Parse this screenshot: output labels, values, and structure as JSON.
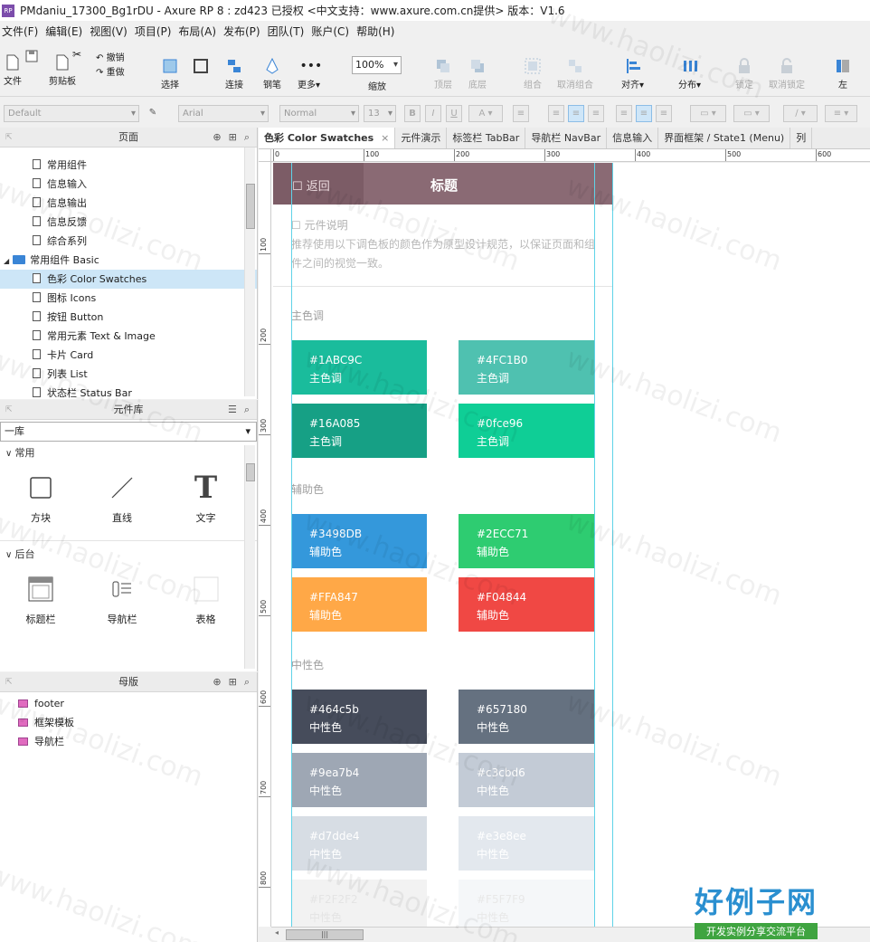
{
  "window": {
    "title": "PMdaniu_17300_Bg1rDU - Axure RP 8  : zd423 已授权       <中文支持：www.axure.com.cn提供> 版本：V1.6",
    "logo": "RP"
  },
  "menu": [
    "文件(F)",
    "编辑(E)",
    "视图(V)",
    "项目(P)",
    "布局(A)",
    "发布(P)",
    "团队(T)",
    "账户(C)",
    "帮助(H)"
  ],
  "toolbar": {
    "file": "文件",
    "clipboard": "剪贴板",
    "undo": "撤销",
    "redo": "重做",
    "select": "选择",
    "connect": "连接",
    "pen": "钢笔",
    "more": "更多▾",
    "zoom_value": "100%",
    "zoom_label": "缩放",
    "top": "顶层",
    "bottom": "底层",
    "group": "组合",
    "ungroup": "取消组合",
    "align": "对齐▾",
    "distribute": "分布▾",
    "lock": "锁定",
    "unlock": "取消锁定",
    "left": "左"
  },
  "format": {
    "style": "Default",
    "font": "Arial",
    "weight": "Normal",
    "size": "13"
  },
  "pages_panel": {
    "title": "页面",
    "items": [
      {
        "label": "常用组件",
        "type": "page",
        "indent": 1
      },
      {
        "label": "信息输入",
        "type": "page",
        "indent": 1
      },
      {
        "label": "信息输出",
        "type": "page",
        "indent": 1
      },
      {
        "label": "信息反馈",
        "type": "page",
        "indent": 1
      },
      {
        "label": "综合系列",
        "type": "page",
        "indent": 1
      },
      {
        "label": "常用组件 Basic",
        "type": "folder",
        "indent": 0
      },
      {
        "label": "色彩 Color Swatches",
        "type": "page",
        "indent": 1,
        "selected": true
      },
      {
        "label": "图标 Icons",
        "type": "page",
        "indent": 1
      },
      {
        "label": "按钮 Button",
        "type": "page",
        "indent": 1
      },
      {
        "label": "常用元素 Text & Image",
        "type": "page",
        "indent": 1
      },
      {
        "label": "卡片 Card",
        "type": "page",
        "indent": 1
      },
      {
        "label": "列表 List",
        "type": "page",
        "indent": 1
      },
      {
        "label": "状态栏 Status Bar",
        "type": "page",
        "indent": 1
      }
    ]
  },
  "library_panel": {
    "title": "元件库",
    "library": "一库",
    "groups": [
      {
        "title": "常用",
        "widgets": [
          {
            "label": "方块",
            "icon": "square-icon"
          },
          {
            "label": "直线",
            "icon": "line-icon"
          },
          {
            "label": "文字",
            "icon": "text-icon"
          }
        ]
      },
      {
        "title": "后台",
        "widgets": [
          {
            "label": "标题栏",
            "icon": "titlebar-icon"
          },
          {
            "label": "导航栏",
            "icon": "navbar-icon"
          },
          {
            "label": "表格",
            "icon": "table-icon"
          }
        ]
      }
    ]
  },
  "masters_panel": {
    "title": "母版",
    "items": [
      "footer",
      "框架模板",
      "导航栏"
    ]
  },
  "tabs": [
    {
      "label": "色彩 Color Swatches",
      "active": true
    },
    {
      "label": "元件演示"
    },
    {
      "label": "标签栏 TabBar"
    },
    {
      "label": "导航栏 NavBar"
    },
    {
      "label": "信息输入"
    },
    {
      "label": "界面框架 / State1 (Menu)"
    },
    {
      "label": "列"
    }
  ],
  "ruler": {
    "h": [
      "0",
      "100",
      "200",
      "300",
      "400",
      "500",
      "600"
    ],
    "v": [
      "100",
      "200",
      "300",
      "400",
      "500",
      "600",
      "700",
      "800"
    ]
  },
  "canvas": {
    "navbar": {
      "back": "☐ 返回",
      "title": "标题",
      "color": "#8a6a74"
    },
    "desc_title": "☐ 元件说明",
    "desc_text": "推荐使用以下调色板的颜色作为原型设计规范，以保证页面和组件之间的视觉一致。",
    "sections": [
      {
        "title": "主色调",
        "swatches": [
          {
            "code": "#1ABC9C",
            "label": "主色调",
            "color": "#1ABC9C",
            "text_color": "#ffffff"
          },
          {
            "code": "#4FC1B0",
            "label": "主色调",
            "color": "#4FC1B0",
            "text_color": "#ffffff"
          },
          {
            "code": "#16A085",
            "label": "主色调",
            "color": "#16A085",
            "text_color": "#ffffff"
          },
          {
            "code": "#0fce96",
            "label": "主色调",
            "color": "#0fce96",
            "text_color": "#ffffff"
          }
        ]
      },
      {
        "title": "辅助色",
        "swatches": [
          {
            "code": "#3498DB",
            "label": "辅助色",
            "color": "#3498DB",
            "text_color": "#ffffff"
          },
          {
            "code": "#2ECC71",
            "label": "辅助色",
            "color": "#2ECC71",
            "text_color": "#ffffff"
          },
          {
            "code": "#FFA847",
            "label": "辅助色",
            "color": "#FFA847",
            "text_color": "#ffffff"
          },
          {
            "code": "#F04844",
            "label": "辅助色",
            "color": "#F04844",
            "text_color": "#ffffff"
          }
        ]
      },
      {
        "title": "中性色",
        "swatches": [
          {
            "code": "#464c5b",
            "label": "中性色",
            "color": "#464c5b",
            "text_color": "#ffffff"
          },
          {
            "code": "#657180",
            "label": "中性色",
            "color": "#657180",
            "text_color": "#ffffff"
          },
          {
            "code": "#9ea7b4",
            "label": "中性色",
            "color": "#9ea7b4",
            "text_color": "#ffffff"
          },
          {
            "code": "#c3cbd6",
            "label": "中性色",
            "color": "#c3cbd6",
            "text_color": "#ffffff"
          },
          {
            "code": "#d7dde4",
            "label": "中性色",
            "color": "#d7dde4",
            "text_color": "#ffffff"
          },
          {
            "code": "#e3e8ee",
            "label": "中性色",
            "color": "#e3e8ee",
            "text_color": "#ffffff"
          },
          {
            "code": "#F2F2F2",
            "label": "中性色",
            "color": "#F2F2F2",
            "text_color": "#e4e4e4"
          },
          {
            "code": "#F5F7F9",
            "label": "中性色",
            "color": "#F5F7F9",
            "text_color": "#e8e8e8"
          }
        ]
      }
    ]
  },
  "watermark": {
    "text": "www.haolizi.com",
    "logo_main": "好例子网",
    "logo_sub": "开发实例分享交流平台"
  }
}
